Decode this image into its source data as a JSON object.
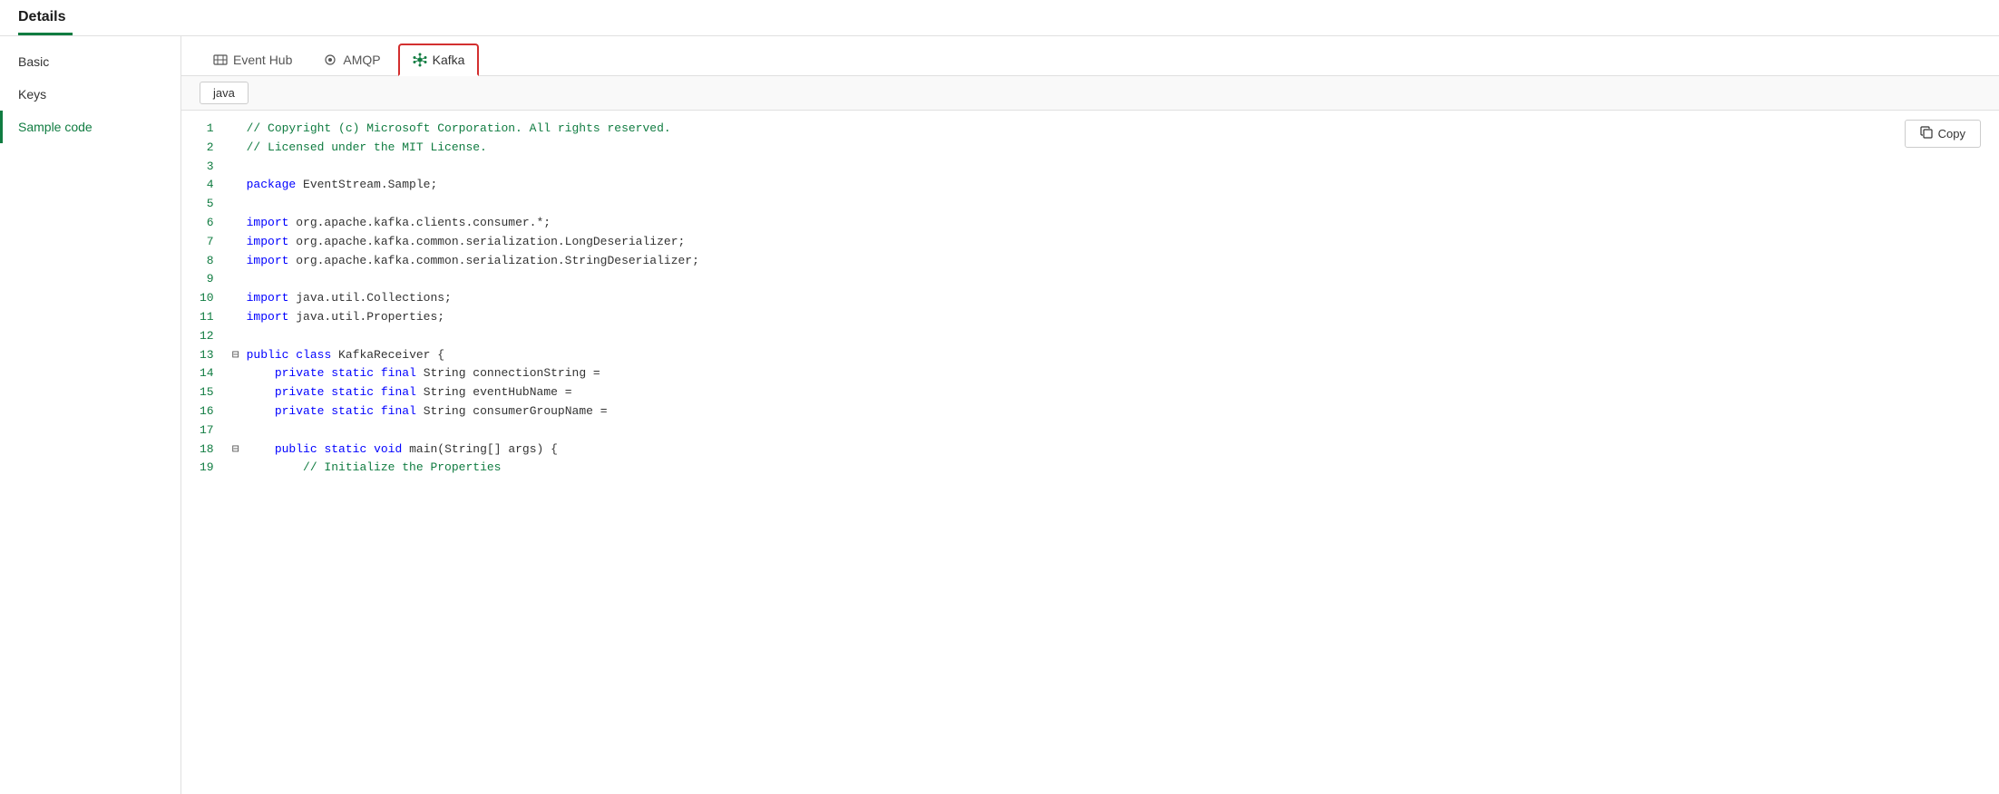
{
  "header": {
    "title": "Details",
    "underline_color": "#107c41"
  },
  "sidebar": {
    "items": [
      {
        "id": "basic",
        "label": "Basic",
        "active": false
      },
      {
        "id": "keys",
        "label": "Keys",
        "active": false
      },
      {
        "id": "sample-code",
        "label": "Sample code",
        "active": true
      }
    ]
  },
  "tabs": [
    {
      "id": "event-hub",
      "label": "Event Hub",
      "active": false,
      "icon": "event-hub-icon"
    },
    {
      "id": "amqp",
      "label": "AMQP",
      "active": false,
      "icon": "amqp-icon"
    },
    {
      "id": "kafka",
      "label": "Kafka",
      "active": true,
      "icon": "kafka-icon"
    }
  ],
  "lang_tab": {
    "label": "java"
  },
  "copy_button": {
    "label": "Copy"
  },
  "code_lines": [
    {
      "num": 1,
      "fold": false,
      "code": "// Copyright (c) Microsoft Corporation. All rights reserved."
    },
    {
      "num": 2,
      "fold": false,
      "code": "// Licensed under the MIT License."
    },
    {
      "num": 3,
      "fold": false,
      "code": ""
    },
    {
      "num": 4,
      "fold": false,
      "code": "package EventStream.Sample;"
    },
    {
      "num": 5,
      "fold": false,
      "code": ""
    },
    {
      "num": 6,
      "fold": false,
      "code": "import org.apache.kafka.clients.consumer.*;"
    },
    {
      "num": 7,
      "fold": false,
      "code": "import org.apache.kafka.common.serialization.LongDeserializer;"
    },
    {
      "num": 8,
      "fold": false,
      "code": "import org.apache.kafka.common.serialization.StringDeserializer;"
    },
    {
      "num": 9,
      "fold": false,
      "code": ""
    },
    {
      "num": 10,
      "fold": false,
      "code": "import java.util.Collections;"
    },
    {
      "num": 11,
      "fold": false,
      "code": "import java.util.Properties;"
    },
    {
      "num": 12,
      "fold": false,
      "code": ""
    },
    {
      "num": 13,
      "fold": true,
      "code": "public class KafkaReceiver {"
    },
    {
      "num": 14,
      "fold": false,
      "code": "    private static final String connectionString ="
    },
    {
      "num": 15,
      "fold": false,
      "code": "    private static final String eventHubName ="
    },
    {
      "num": 16,
      "fold": false,
      "code": "    private static final String consumerGroupName ="
    },
    {
      "num": 17,
      "fold": false,
      "code": ""
    },
    {
      "num": 18,
      "fold": true,
      "code": "    public static void main(String[] args) {"
    },
    {
      "num": 19,
      "fold": false,
      "code": "        // Initialize the Properties"
    }
  ],
  "colors": {
    "active_tab_border": "#d32f2f",
    "sidebar_active": "#107c41",
    "comment_color": "#107c41",
    "keyword_color": "#0000ff",
    "kafka_icon_color": "#107c41"
  }
}
